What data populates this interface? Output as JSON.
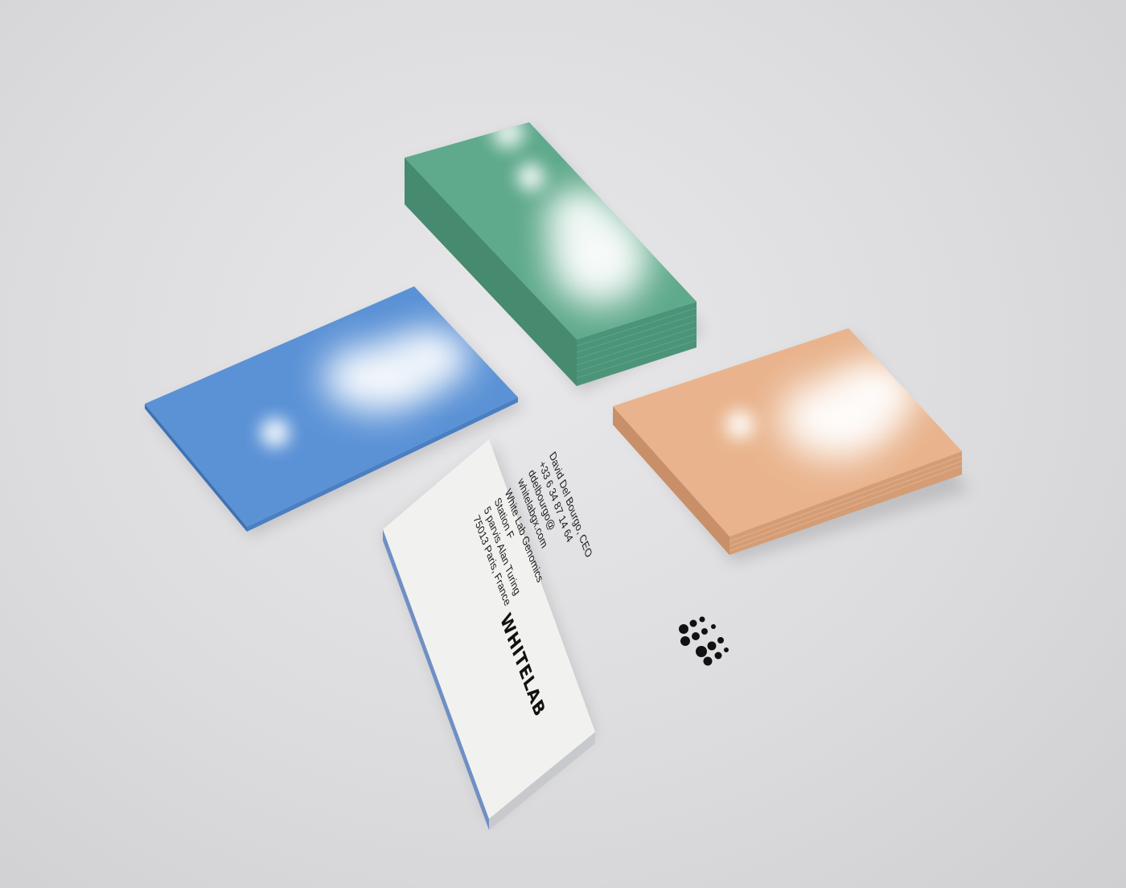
{
  "scene": {
    "background_color": "#dddddf",
    "cards": [
      {
        "id": "blue",
        "color": "#5b92d6",
        "edge_color": "#4a7fc2",
        "surface": "blurred white blob"
      },
      {
        "id": "green",
        "color": "#5faa8c",
        "edge_color": "#4c9479",
        "surface": "blurred white blob"
      },
      {
        "id": "peach",
        "color": "#e9b48d",
        "edge_color": "#d49d75",
        "surface": "blurred white blob"
      },
      {
        "id": "white-front",
        "color": "#f1f1ef",
        "edge_color": "#6f8fc4"
      }
    ]
  },
  "business_card": {
    "lines": [
      "David Del Bourgo, CEO",
      "+33 6 34 87 14 64",
      "ddelbourgo@",
      "whitelabgx.com",
      "White Lab Genomics",
      "Station F",
      "5 parvis Alan Turing",
      "75013 Paris, France"
    ],
    "wordmark": "WHITELAB",
    "logo_icon": "whitelab-dots-logo-icon"
  }
}
